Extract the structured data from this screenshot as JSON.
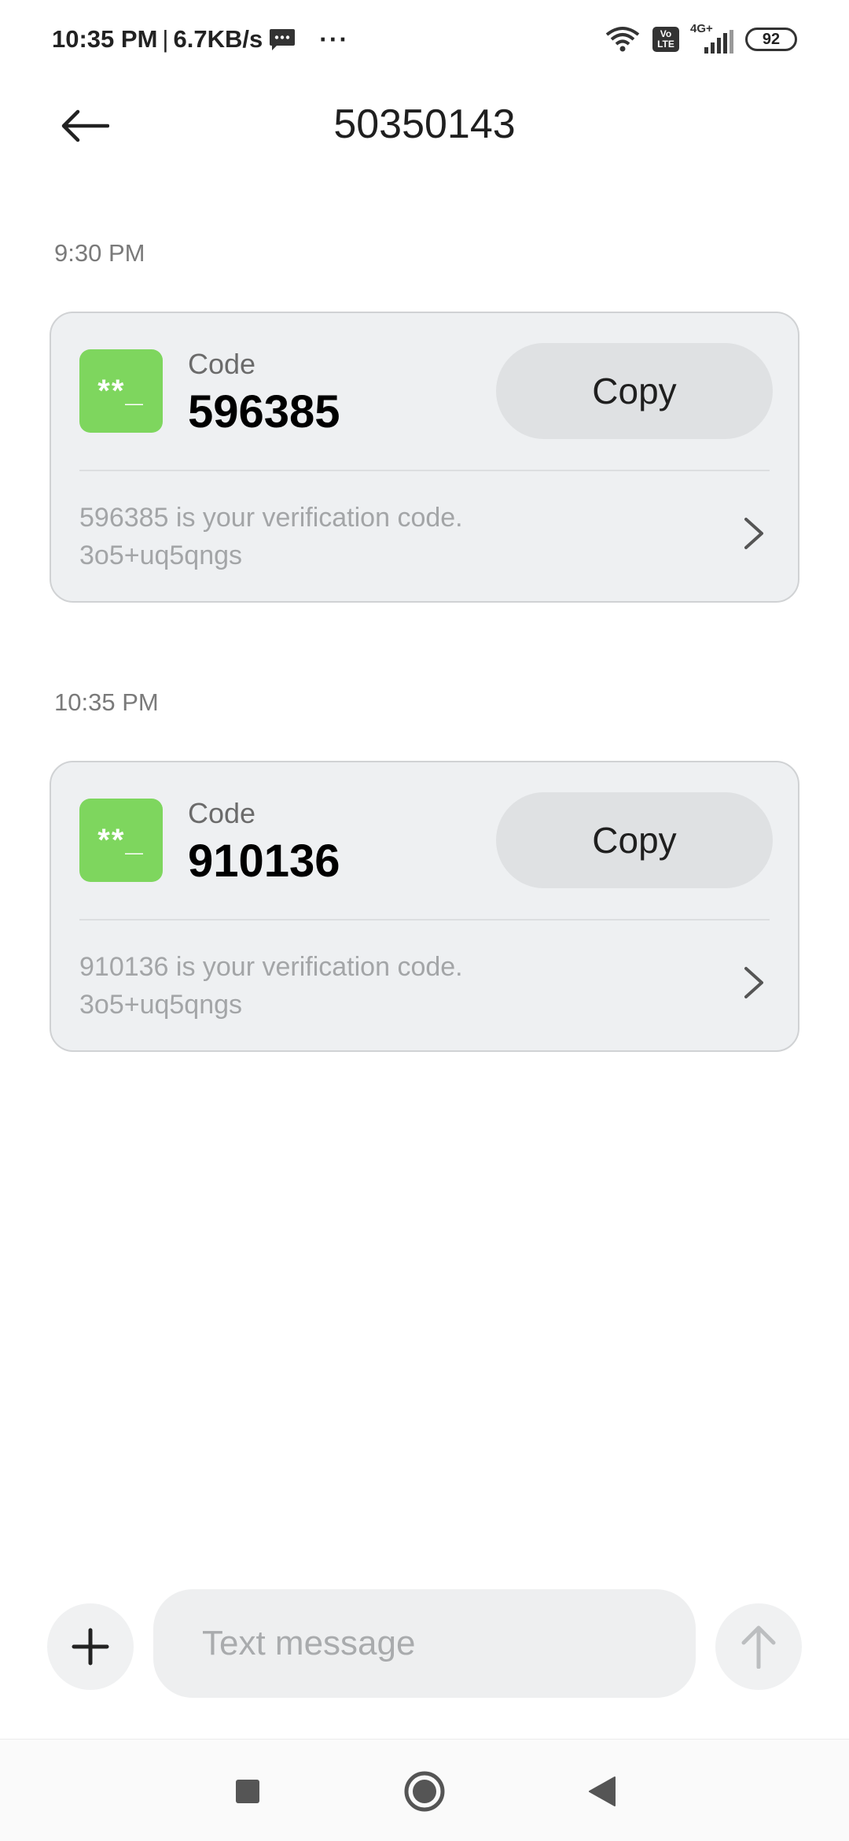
{
  "status_bar": {
    "time": "10:35 PM",
    "separator": "|",
    "speed": "6.7KB/s",
    "more": "···",
    "network": "4G+",
    "volte": "Vo LTE",
    "battery": "92",
    "icons": [
      "message-icon",
      "wifi-icon",
      "volte-icon",
      "signal-icon",
      "battery-icon"
    ]
  },
  "header": {
    "title": "50350143",
    "back_icon": "arrow-left-icon"
  },
  "messages": [
    {
      "time": "9:30 PM",
      "code_label": "Code",
      "code": "596385",
      "icon_text": "**_",
      "copy_label": "Copy",
      "body_line1": "596385 is your verification code.",
      "body_line2": "3o5+uq5qngs"
    },
    {
      "time": "10:35 PM",
      "code_label": "Code",
      "code": "910136",
      "icon_text": "**_",
      "copy_label": "Copy",
      "body_line1": "910136 is your verification code.",
      "body_line2": "3o5+uq5qngs"
    }
  ],
  "composer": {
    "placeholder": "Text message",
    "add_icon": "plus-icon",
    "send_icon": "arrow-up-icon"
  },
  "nav": {
    "icons": [
      "square-icon",
      "circle-icon",
      "triangle-back-icon"
    ]
  },
  "colors": {
    "code_icon_bg": "#7ed65e",
    "card_bg": "#eef0f2",
    "copy_bg": "#dfe1e3"
  }
}
